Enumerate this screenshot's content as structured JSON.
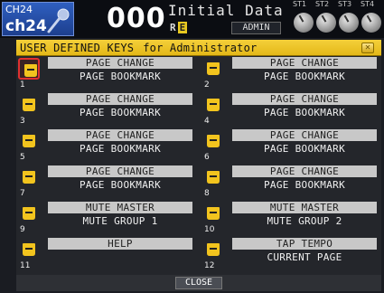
{
  "header": {
    "channel_short": "CH24",
    "channel_name": "ch24",
    "mic_icon": "microphone-icon",
    "scene_number": "000",
    "scene_title": "Initial Data",
    "re_label": "R",
    "re_flag": "E",
    "user_label": "ADMIN",
    "st_labels": [
      "ST1",
      "ST2",
      "ST3",
      "ST4"
    ]
  },
  "window": {
    "title": "USER DEFINED KEYS",
    "subtitle": "for Administrator",
    "close_icon": "x-icon",
    "keys": [
      {
        "number": "1",
        "function": "PAGE CHANGE",
        "parameter": "PAGE BOOKMARK",
        "selected": true
      },
      {
        "number": "2",
        "function": "PAGE CHANGE",
        "parameter": "PAGE BOOKMARK"
      },
      {
        "number": "3",
        "function": "PAGE CHANGE",
        "parameter": "PAGE BOOKMARK"
      },
      {
        "number": "4",
        "function": "PAGE CHANGE",
        "parameter": "PAGE BOOKMARK"
      },
      {
        "number": "5",
        "function": "PAGE CHANGE",
        "parameter": "PAGE BOOKMARK"
      },
      {
        "number": "6",
        "function": "PAGE CHANGE",
        "parameter": "PAGE BOOKMARK"
      },
      {
        "number": "7",
        "function": "PAGE CHANGE",
        "parameter": "PAGE BOOKMARK"
      },
      {
        "number": "8",
        "function": "PAGE CHANGE",
        "parameter": "PAGE BOOKMARK"
      },
      {
        "number": "9",
        "function": "MUTE MASTER",
        "parameter": "MUTE GROUP 1"
      },
      {
        "number": "10",
        "function": "MUTE MASTER",
        "parameter": "MUTE GROUP 2"
      },
      {
        "number": "11",
        "function": "HELP",
        "parameter": ""
      },
      {
        "number": "12",
        "function": "TAP TEMPO",
        "parameter": "CURRENT PAGE"
      }
    ],
    "close_label": "CLOSE"
  },
  "colors": {
    "title_bar": "#f0c828",
    "selected_outline": "#e03030",
    "channel_box": "#2a55b0",
    "key_icon": "#f2c41e"
  }
}
